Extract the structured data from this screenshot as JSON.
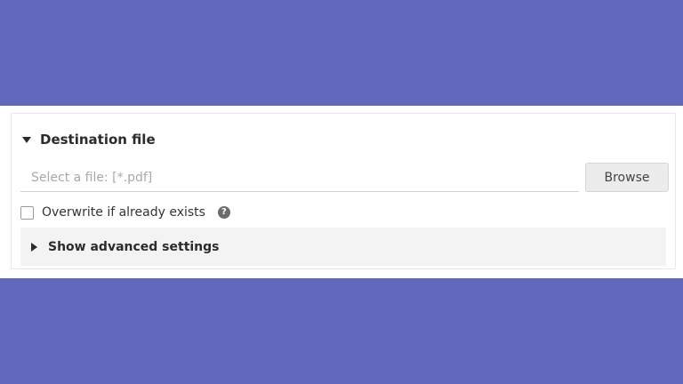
{
  "section": {
    "title": "Destination file",
    "expanded": true
  },
  "file_input": {
    "placeholder": "Select a file: [*.pdf]",
    "value": ""
  },
  "browse_button": {
    "label": "Browse"
  },
  "overwrite": {
    "label": "Overwrite if already exists",
    "checked": false,
    "help_icon": "?"
  },
  "advanced": {
    "label": "Show advanced settings",
    "expanded": false
  },
  "colors": {
    "background": "#6268bc",
    "panel": "#ffffff",
    "advanced_bg": "#f3f3f3",
    "button_bg": "#ececec"
  },
  "icons": {
    "section_toggle": "caret-down-icon",
    "advanced_toggle": "caret-right-icon",
    "help": "help-icon"
  }
}
